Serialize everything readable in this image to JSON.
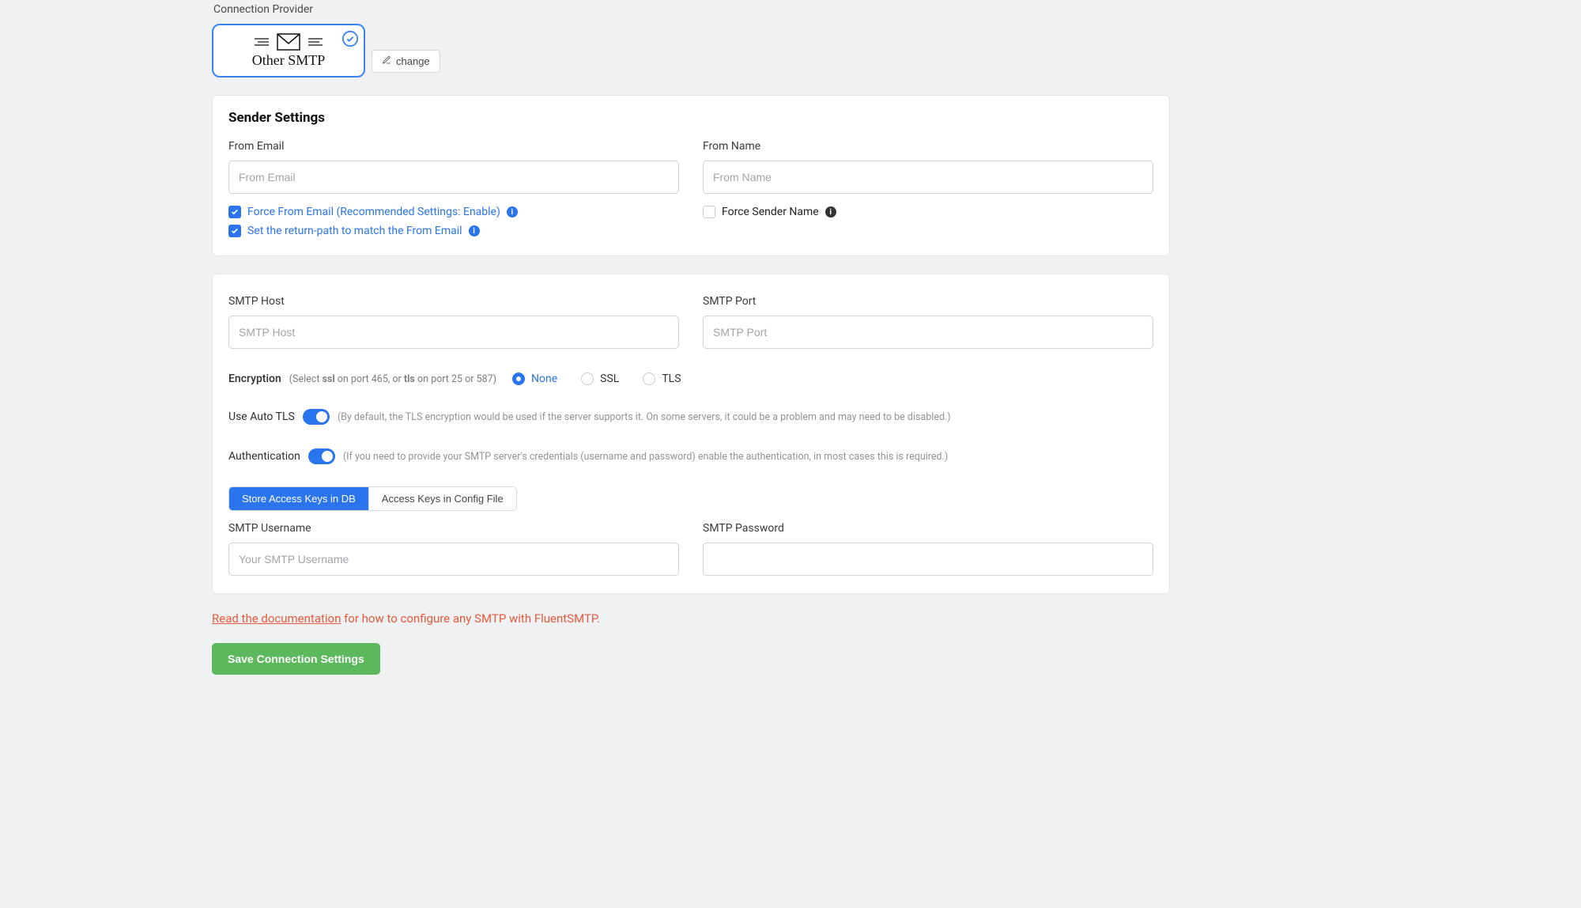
{
  "provider": {
    "section_label": "Connection Provider",
    "title": "Other SMTP",
    "change_label": "change"
  },
  "sender_settings": {
    "heading": "Sender Settings",
    "from_email_label": "From Email",
    "from_email_placeholder": "From Email",
    "from_name_label": "From Name",
    "from_name_placeholder": "From Name",
    "force_from_email": "Force From Email (Recommended Settings: Enable)",
    "return_path": "Set the return-path to match the From Email",
    "force_sender_name": "Force Sender Name"
  },
  "smtp": {
    "host_label": "SMTP Host",
    "host_placeholder": "SMTP Host",
    "port_label": "SMTP Port",
    "port_placeholder": "SMTP Port",
    "encryption_label": "Encryption",
    "encryption_hint_pre": "(Select ",
    "encryption_hint_ssl": "ssl",
    "encryption_hint_mid1": " on port 465, or ",
    "encryption_hint_tls": "tls",
    "encryption_hint_mid2": " on port 25 or 587)",
    "enc_none": "None",
    "enc_ssl": "SSL",
    "enc_tls": "TLS",
    "auto_tls_label": "Use Auto TLS",
    "auto_tls_note": "(By default, the TLS encryption would be used if the server supports it. On some servers, it could be a problem and may need to be disabled.)",
    "auth_label": "Authentication",
    "auth_note": "(If you need to provide your SMTP server's credentials (username and password) enable the authentication, in most cases this is required.)",
    "pill_db": "Store Access Keys in DB",
    "pill_config": "Access Keys in Config File",
    "username_label": "SMTP Username",
    "username_placeholder": "Your SMTP Username",
    "password_label": "SMTP Password"
  },
  "footer": {
    "doc_link": "Read the documentation",
    "doc_suffix": " for how to configure any SMTP with FluentSMTP.",
    "save": "Save Connection Settings"
  }
}
